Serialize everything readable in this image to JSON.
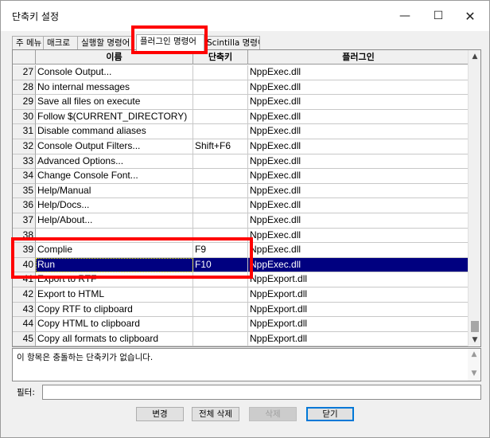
{
  "window": {
    "title": "단축키 설정",
    "minimize_glyph": "—",
    "maximize_glyph": "☐",
    "close_glyph": "✕"
  },
  "tabs": [
    {
      "label": "주 메뉴"
    },
    {
      "label": "매크로"
    },
    {
      "label": "실행할 명령어"
    },
    {
      "label": "플러그인 명령어",
      "active": true
    },
    {
      "label": "Scintilla 명령어"
    }
  ],
  "table": {
    "headers": [
      "",
      "이름",
      "단축키",
      "플러그인"
    ],
    "rows": [
      {
        "num": "27",
        "name": "Console Output...",
        "shortcut": "",
        "plugin": "NppExec.dll"
      },
      {
        "num": "28",
        "name": "No internal messages",
        "shortcut": "",
        "plugin": "NppExec.dll"
      },
      {
        "num": "29",
        "name": "Save all files on execute",
        "shortcut": "",
        "plugin": "NppExec.dll"
      },
      {
        "num": "30",
        "name": "Follow $(CURRENT_DIRECTORY)",
        "shortcut": "",
        "plugin": "NppExec.dll"
      },
      {
        "num": "31",
        "name": "Disable command aliases",
        "shortcut": "",
        "plugin": "NppExec.dll"
      },
      {
        "num": "32",
        "name": "Console Output Filters...",
        "shortcut": "Shift+F6",
        "plugin": "NppExec.dll"
      },
      {
        "num": "33",
        "name": "Advanced Options...",
        "shortcut": "",
        "plugin": "NppExec.dll"
      },
      {
        "num": "34",
        "name": "Change Console Font...",
        "shortcut": "",
        "plugin": "NppExec.dll"
      },
      {
        "num": "35",
        "name": "Help/Manual",
        "shortcut": "",
        "plugin": "NppExec.dll"
      },
      {
        "num": "36",
        "name": "Help/Docs...",
        "shortcut": "",
        "plugin": "NppExec.dll"
      },
      {
        "num": "37",
        "name": "Help/About...",
        "shortcut": "",
        "plugin": "NppExec.dll"
      },
      {
        "num": "38",
        "name": "",
        "shortcut": "",
        "plugin": "NppExec.dll"
      },
      {
        "num": "39",
        "name": "Complie",
        "shortcut": "F9",
        "plugin": "NppExec.dll"
      },
      {
        "num": "40",
        "name": "Run",
        "shortcut": "F10",
        "plugin": "NppExec.dll",
        "selected": true
      },
      {
        "num": "41",
        "name": "Export to RTF",
        "shortcut": "",
        "plugin": "NppExport.dll"
      },
      {
        "num": "42",
        "name": "Export to HTML",
        "shortcut": "",
        "plugin": "NppExport.dll"
      },
      {
        "num": "43",
        "name": "Copy RTF to clipboard",
        "shortcut": "",
        "plugin": "NppExport.dll"
      },
      {
        "num": "44",
        "name": "Copy HTML to clipboard",
        "shortcut": "",
        "plugin": "NppExport.dll"
      },
      {
        "num": "45",
        "name": "Copy all formats to clipboard",
        "shortcut": "",
        "plugin": "NppExport.dll"
      }
    ],
    "scroll_up_glyph": "▲",
    "scroll_down_glyph": "▼"
  },
  "description": {
    "text": "이 항목은 충돌하는 단축키가 없습니다."
  },
  "filter": {
    "label": "필터:",
    "value": ""
  },
  "buttons": {
    "modify": "변경",
    "clear_all": "전체 삭제",
    "delete": "삭제",
    "close": "닫기"
  },
  "colors": {
    "selection": "#000080",
    "annotation": "#ff0000"
  }
}
